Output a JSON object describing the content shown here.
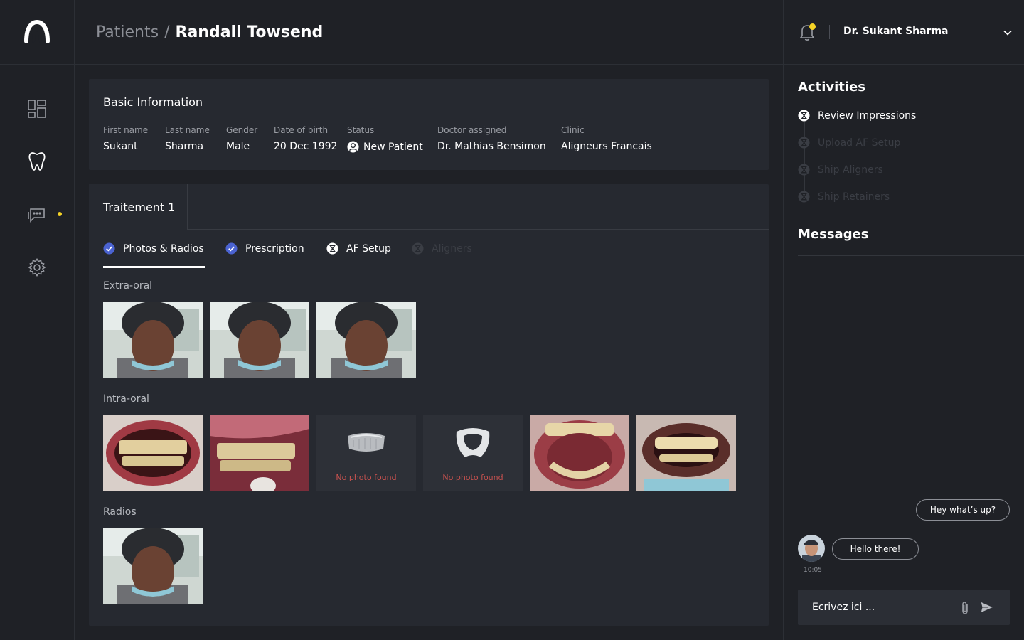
{
  "breadcrumb": {
    "root": "Patients",
    "separator": "/",
    "current": "Randall Towsend"
  },
  "user": {
    "name": "Dr. Sukant Sharma"
  },
  "colors": {
    "accent_dot": "#f5d326",
    "check_blue": "#4b63d1",
    "no_photo_red": "#c9524f"
  },
  "basic_info": {
    "title": "Basic Information",
    "fields": [
      {
        "label": "First name",
        "value": "Sukant"
      },
      {
        "label": "Last name",
        "value": "Sharma"
      },
      {
        "label": "Gender",
        "value": "Male"
      },
      {
        "label": "Date of birth",
        "value": "20 Dec 1992"
      },
      {
        "label": "Status",
        "value": "New Patient"
      },
      {
        "label": "Doctor assigned",
        "value": "Dr. Mathias Bensimon"
      },
      {
        "label": "Clinic",
        "value": "Aligneurs Francais"
      }
    ]
  },
  "treatment": {
    "tab": "Traitement 1",
    "steps": [
      {
        "label": "Photos & Radios",
        "state": "done",
        "active": true
      },
      {
        "label": "Prescription",
        "state": "done"
      },
      {
        "label": "AF Setup",
        "state": "pending"
      },
      {
        "label": "Aligners",
        "state": "disabled"
      }
    ],
    "sections": {
      "extra_oral": "Extra-oral",
      "intra_oral": "Intra-oral",
      "radios": "Radios"
    },
    "no_photo_text": "No photo found"
  },
  "activities": {
    "title": "Activities",
    "items": [
      {
        "label": "Review Impressions",
        "state": "current"
      },
      {
        "label": "Upload AF Setup",
        "state": "disabled"
      },
      {
        "label": "Ship Aligners",
        "state": "disabled"
      },
      {
        "label": "Ship Retainers",
        "state": "disabled"
      }
    ]
  },
  "messages": {
    "title": "Messages",
    "outgoing": "Hey what’s up?",
    "incoming": "Hello there!",
    "time": "10:05",
    "placeholder": "Écrivez ici ..."
  }
}
